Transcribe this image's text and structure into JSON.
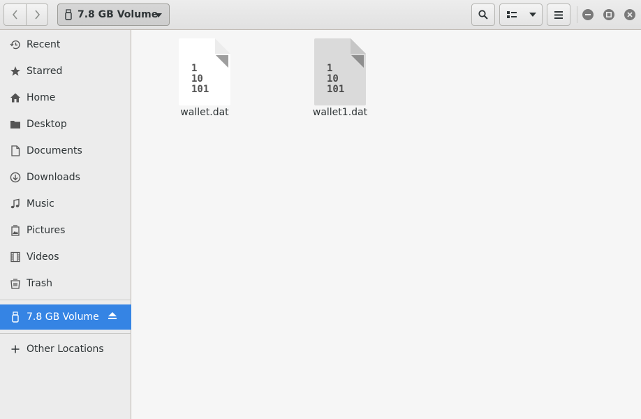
{
  "header": {
    "back_icon": "chevron-left-icon",
    "forward_icon": "chevron-right-icon",
    "path_label": "7.8 GB Volume",
    "search_icon": "search-icon",
    "view_icon": "list-view-icon",
    "menu_icon": "hamburger-icon",
    "window_controls": [
      "minimize",
      "maximize",
      "close"
    ]
  },
  "sidebar": {
    "items": [
      {
        "label": "Recent",
        "icon": "clock-icon"
      },
      {
        "label": "Starred",
        "icon": "star-icon"
      },
      {
        "label": "Home",
        "icon": "home-icon"
      },
      {
        "label": "Desktop",
        "icon": "folder-icon"
      },
      {
        "label": "Documents",
        "icon": "document-icon"
      },
      {
        "label": "Downloads",
        "icon": "download-icon"
      },
      {
        "label": "Music",
        "icon": "music-icon"
      },
      {
        "label": "Pictures",
        "icon": "picture-icon"
      },
      {
        "label": "Videos",
        "icon": "film-icon"
      },
      {
        "label": "Trash",
        "icon": "trash-icon"
      }
    ],
    "volume": {
      "label": "7.8 GB Volume",
      "icon": "usb-drive-icon",
      "eject_icon": "eject-icon",
      "active": true
    },
    "other": {
      "label": "Other Locations",
      "icon": "plus-icon"
    }
  },
  "files": [
    {
      "name": "wallet.dat",
      "icon": "binary-file-icon",
      "selected": false
    },
    {
      "name": "wallet1.dat",
      "icon": "binary-file-icon",
      "selected": true
    }
  ],
  "colors": {
    "accent": "#3584e4",
    "file_icon": "#ffffff",
    "file_icon_selected": "#dadada"
  }
}
